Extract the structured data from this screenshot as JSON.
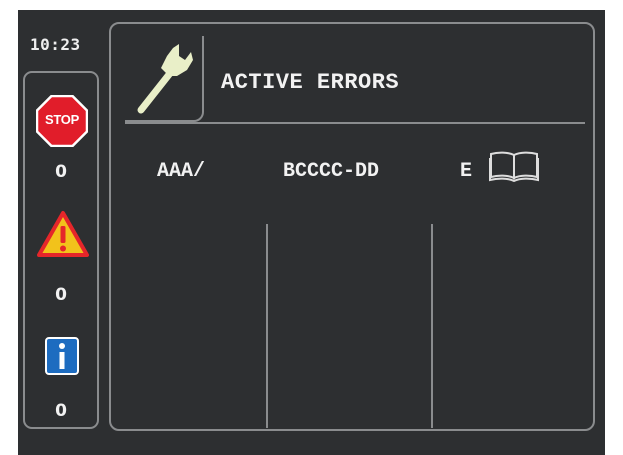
{
  "status": {
    "time": "10:23"
  },
  "sidebar": {
    "items": [
      {
        "icon": "stop-sign-icon",
        "icon_text": "STOP",
        "count": "0"
      },
      {
        "icon": "warning-triangle-icon",
        "count": "0"
      },
      {
        "icon": "info-icon",
        "count": "0"
      }
    ]
  },
  "main": {
    "icon": "wrench-icon",
    "title": "ACTIVE ERRORS",
    "columns": [
      "AAA/",
      "BCCCC-DD",
      "E"
    ],
    "manual_icon": "book-icon"
  },
  "colors": {
    "background": "#2d2f31",
    "border": "#8a8c8e",
    "stop_red": "#e11d2a",
    "warning_yellow": "#f2c21b",
    "info_blue": "#1d6cc0",
    "wrench": "#e9efc8"
  }
}
